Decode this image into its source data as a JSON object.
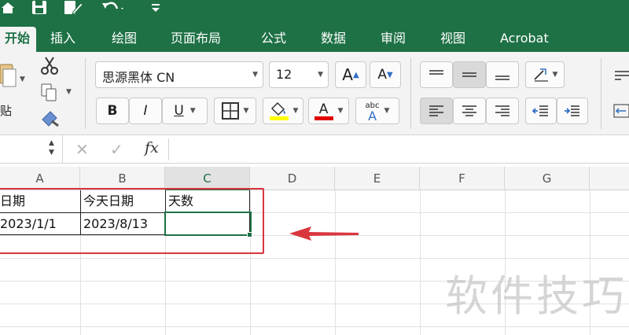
{
  "ribbon_tabs": [
    "开始",
    "插入",
    "绘图",
    "页面布局",
    "公式",
    "数据",
    "审阅",
    "视图",
    "Acrobat"
  ],
  "clipboard": {
    "paste_label": "贴"
  },
  "font": {
    "name": "思源黑体 CN",
    "size": "12",
    "bold": "B",
    "italic": "I",
    "underline": "U",
    "grow": "A",
    "shrink": "A",
    "font_color_letter": "A",
    "phonetic_top": "abc",
    "phonetic_bottom": "A"
  },
  "formula_bar": {
    "fx_label": "fx",
    "name_box_value": "",
    "formula_value": ""
  },
  "columns": [
    "A",
    "B",
    "C",
    "D",
    "E",
    "F",
    "G"
  ],
  "selected_column": "C",
  "rows": [
    [
      "日期",
      "今天日期",
      "天数"
    ],
    [
      "2023/1/1",
      "2023/8/13",
      ""
    ]
  ],
  "watermark": "软件技巧",
  "colors": {
    "excel_green": "#1e7145",
    "annotation_red": "#d9363e",
    "highlight_yellow": "#ffff00",
    "font_red": "#e00000"
  }
}
